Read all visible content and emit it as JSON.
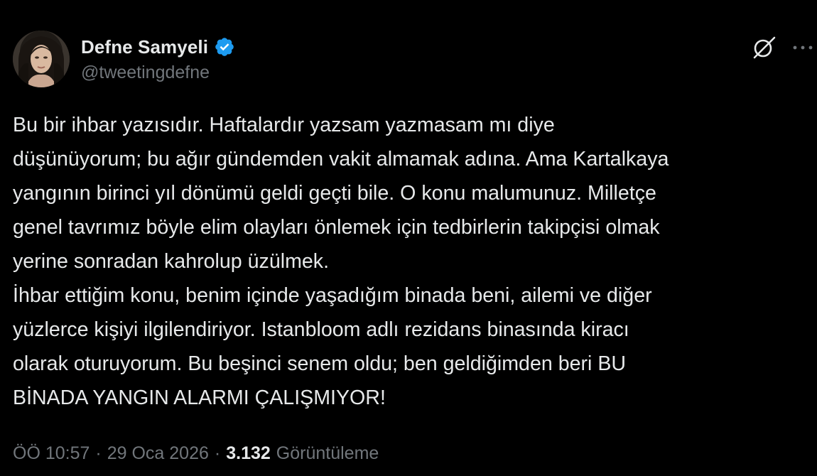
{
  "author": {
    "display_name": "Defne Samyeli",
    "handle": "@tweetingdefne",
    "verified_icon": "verified-badge-icon",
    "verified_color": "#1d9bf0"
  },
  "actions": {
    "grok_icon": "grok-icon",
    "more_icon": "more-options-icon"
  },
  "tweet": {
    "lines": [
      "Bu bir ihbar yazısıdır. Haftalardır yazsam yazmasam mı diye",
      "düşünüyorum; bu ağır gündemden vakit almamak adına. Ama Kartalkaya",
      "yangının birinci yıl dönümü geldi geçti bile. O konu malumunuz. Milletçe",
      "genel tavrımız böyle elim olayları önlemek için tedbirlerin takipçisi olmak",
      "yerine sonradan kahrolup üzülmek.",
      "İhbar ettiğim konu, benim içinde yaşadığım binada beni, ailemi ve diğer",
      "yüzlerce kişiyi ilgilendiriyor. Istanbloom adlı rezidans binasında kiracı",
      "olarak oturuyorum. Bu beşinci senem oldu; ben geldiğimden beri BU",
      "BİNADA YANGIN ALARMI ÇALIŞMIYOR!"
    ]
  },
  "meta": {
    "time": "ÖÖ 10:57",
    "separator": "·",
    "date": "29 Oca 2026",
    "views_count": "3.132",
    "views_label": "Görüntüleme"
  },
  "colors": {
    "background": "#000000",
    "text": "#e7e9ea",
    "secondary": "#71767b"
  }
}
